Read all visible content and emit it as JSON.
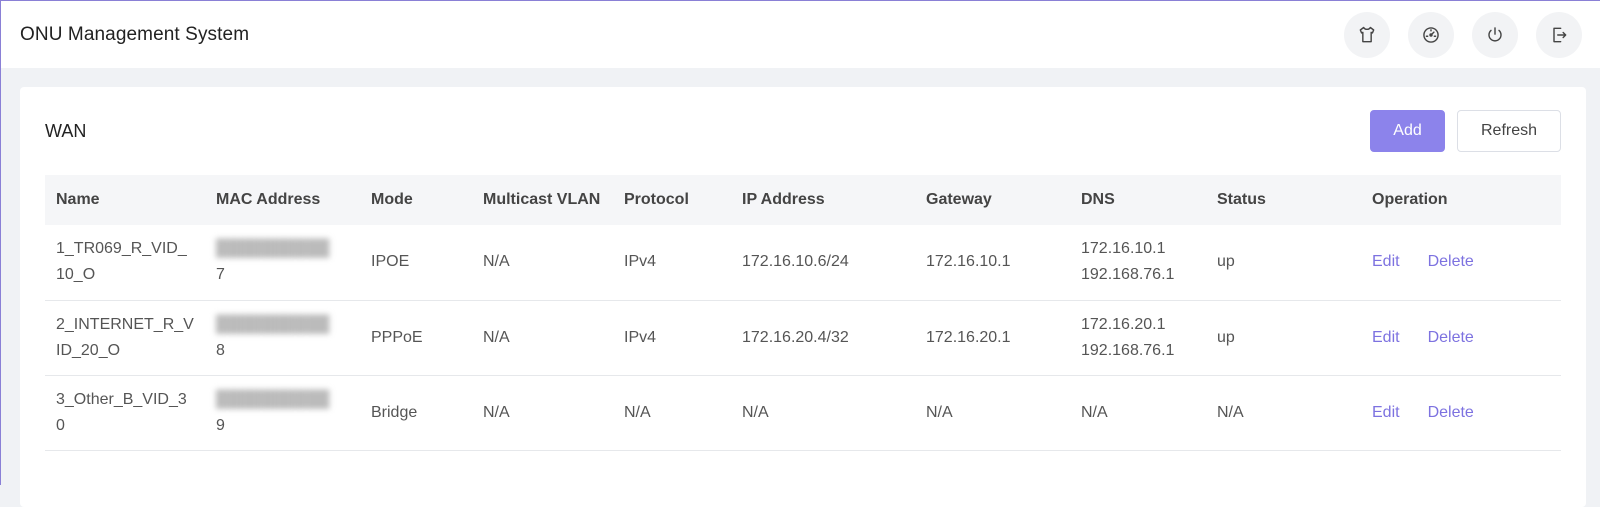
{
  "app": {
    "title": "ONU Management System"
  },
  "header_icons": [
    {
      "name": "theme-shirt-icon"
    },
    {
      "name": "dashboard-icon"
    },
    {
      "name": "power-icon"
    },
    {
      "name": "logout-icon"
    }
  ],
  "panel": {
    "title": "WAN",
    "add_label": "Add",
    "refresh_label": "Refresh"
  },
  "table": {
    "columns": [
      "Name",
      "MAC Address",
      "Mode",
      "Multicast VLAN",
      "Protocol",
      "IP Address",
      "Gateway",
      "DNS",
      "Status",
      "Operation"
    ],
    "rows": [
      {
        "name": "1_TR069_R_VID_10_O",
        "mac_visible_suffix": "7",
        "mode": "IPOE",
        "multicast_vlan": "N/A",
        "protocol": "IPv4",
        "ip": "172.16.10.6/24",
        "gateway": "172.16.10.1",
        "dns1": "172.16.10.1",
        "dns2": "192.168.76.1",
        "status": "up",
        "edit": "Edit",
        "delete": "Delete"
      },
      {
        "name": "2_INTERNET_R_VID_20_O",
        "mac_visible_suffix": "8",
        "mode": "PPPoE",
        "multicast_vlan": "N/A",
        "protocol": "IPv4",
        "ip": "172.16.20.4/32",
        "gateway": "172.16.20.1",
        "dns1": "172.16.20.1",
        "dns2": "192.168.76.1",
        "status": "up",
        "edit": "Edit",
        "delete": "Delete"
      },
      {
        "name": "3_Other_B_VID_30",
        "mac_visible_suffix": "9",
        "mode": "Bridge",
        "multicast_vlan": "N/A",
        "protocol": "N/A",
        "ip": "N/A",
        "gateway": "N/A",
        "dns1": "N/A",
        "dns2": "",
        "status": "N/A",
        "edit": "Edit",
        "delete": "Delete"
      }
    ]
  },
  "colors": {
    "accent": "#8c83eb",
    "link": "#7d72e0",
    "background": "#f0f2f5"
  }
}
